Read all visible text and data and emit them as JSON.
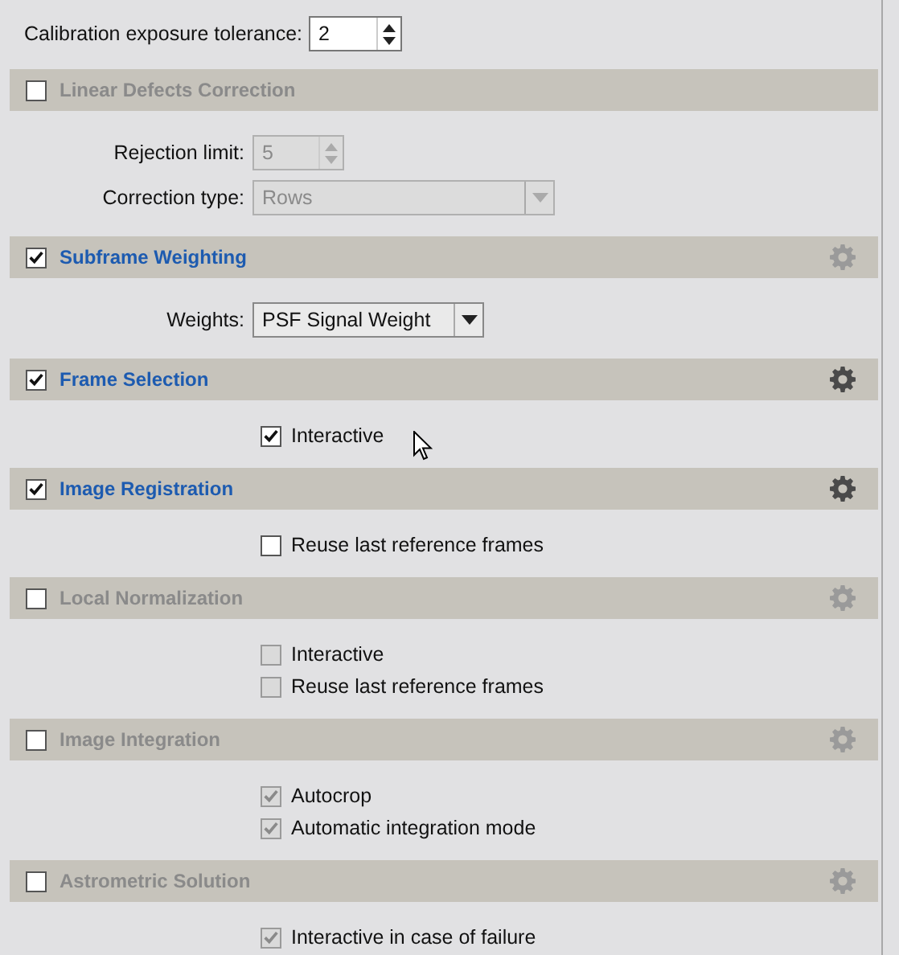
{
  "top_field": {
    "label": "Calibration exposure tolerance:",
    "value": "2"
  },
  "sections": [
    {
      "title": "Linear Defects Correction",
      "checked": false,
      "items": [
        {
          "kind": "spin",
          "label": "Rejection limit:",
          "value": "5",
          "disabled": true
        },
        {
          "kind": "combo",
          "label": "Correction type:",
          "value": "Rows",
          "disabled": true
        }
      ]
    },
    {
      "title": "Subframe Weighting",
      "checked": true,
      "settings_disabled": true,
      "items": [
        {
          "kind": "combo",
          "label": "Weights:",
          "value": "PSF Signal Weight",
          "disabled": false
        }
      ]
    },
    {
      "title": "Frame Selection",
      "checked": true,
      "settings_disabled": false,
      "items": [
        {
          "kind": "checkbox",
          "label": "Interactive",
          "checked": true,
          "disabled": false
        }
      ]
    },
    {
      "title": "Image Registration",
      "checked": true,
      "settings_disabled": false,
      "items": [
        {
          "kind": "checkbox",
          "label": "Reuse last reference frames",
          "checked": false,
          "disabled": false
        }
      ]
    },
    {
      "title": "Local Normalization",
      "checked": false,
      "settings_disabled": true,
      "items": [
        {
          "kind": "checkbox",
          "label": "Interactive",
          "checked": false,
          "disabled": true
        },
        {
          "kind": "checkbox",
          "label": "Reuse last reference frames",
          "checked": false,
          "disabled": true
        }
      ]
    },
    {
      "title": "Image Integration",
      "checked": false,
      "settings_disabled": true,
      "items": [
        {
          "kind": "checkbox",
          "label": "Autocrop",
          "checked": true,
          "disabled": true
        },
        {
          "kind": "checkbox",
          "label": "Automatic integration mode",
          "checked": true,
          "disabled": true
        }
      ]
    },
    {
      "title": "Astrometric Solution",
      "checked": false,
      "settings_disabled": true,
      "items": [
        {
          "kind": "checkbox",
          "label": "Interactive in case of failure",
          "checked": true,
          "disabled": true
        }
      ]
    }
  ]
}
